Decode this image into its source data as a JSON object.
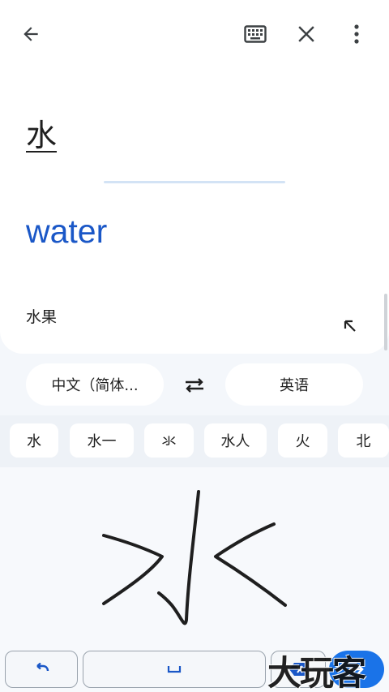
{
  "toolbar": {
    "back_icon": "arrow-back-icon",
    "keyboard_icon": "keyboard-icon",
    "close_icon": "close-icon",
    "more_icon": "more-vert-icon"
  },
  "source": {
    "text": "水"
  },
  "translation": {
    "text": "water"
  },
  "suggestion": {
    "text": "水果",
    "icon": "insert-arrow-icon"
  },
  "languages": {
    "source_label": "中文（简体...",
    "target_label": "英语",
    "swap_icon": "swap-icon"
  },
  "candidates": [
    "水",
    "水一",
    "氺",
    "水人",
    "火",
    "北"
  ],
  "bottom_bar": {
    "undo_icon": "undo-icon",
    "space_icon": "space-icon",
    "backspace_icon": "backspace-icon",
    "go_icon": "go-arrow-icon"
  },
  "watermark": {
    "text": "大玩客"
  },
  "colors": {
    "accent": "#1a57c7",
    "go_button": "#1a73e8",
    "background": "#f4f7fb"
  }
}
